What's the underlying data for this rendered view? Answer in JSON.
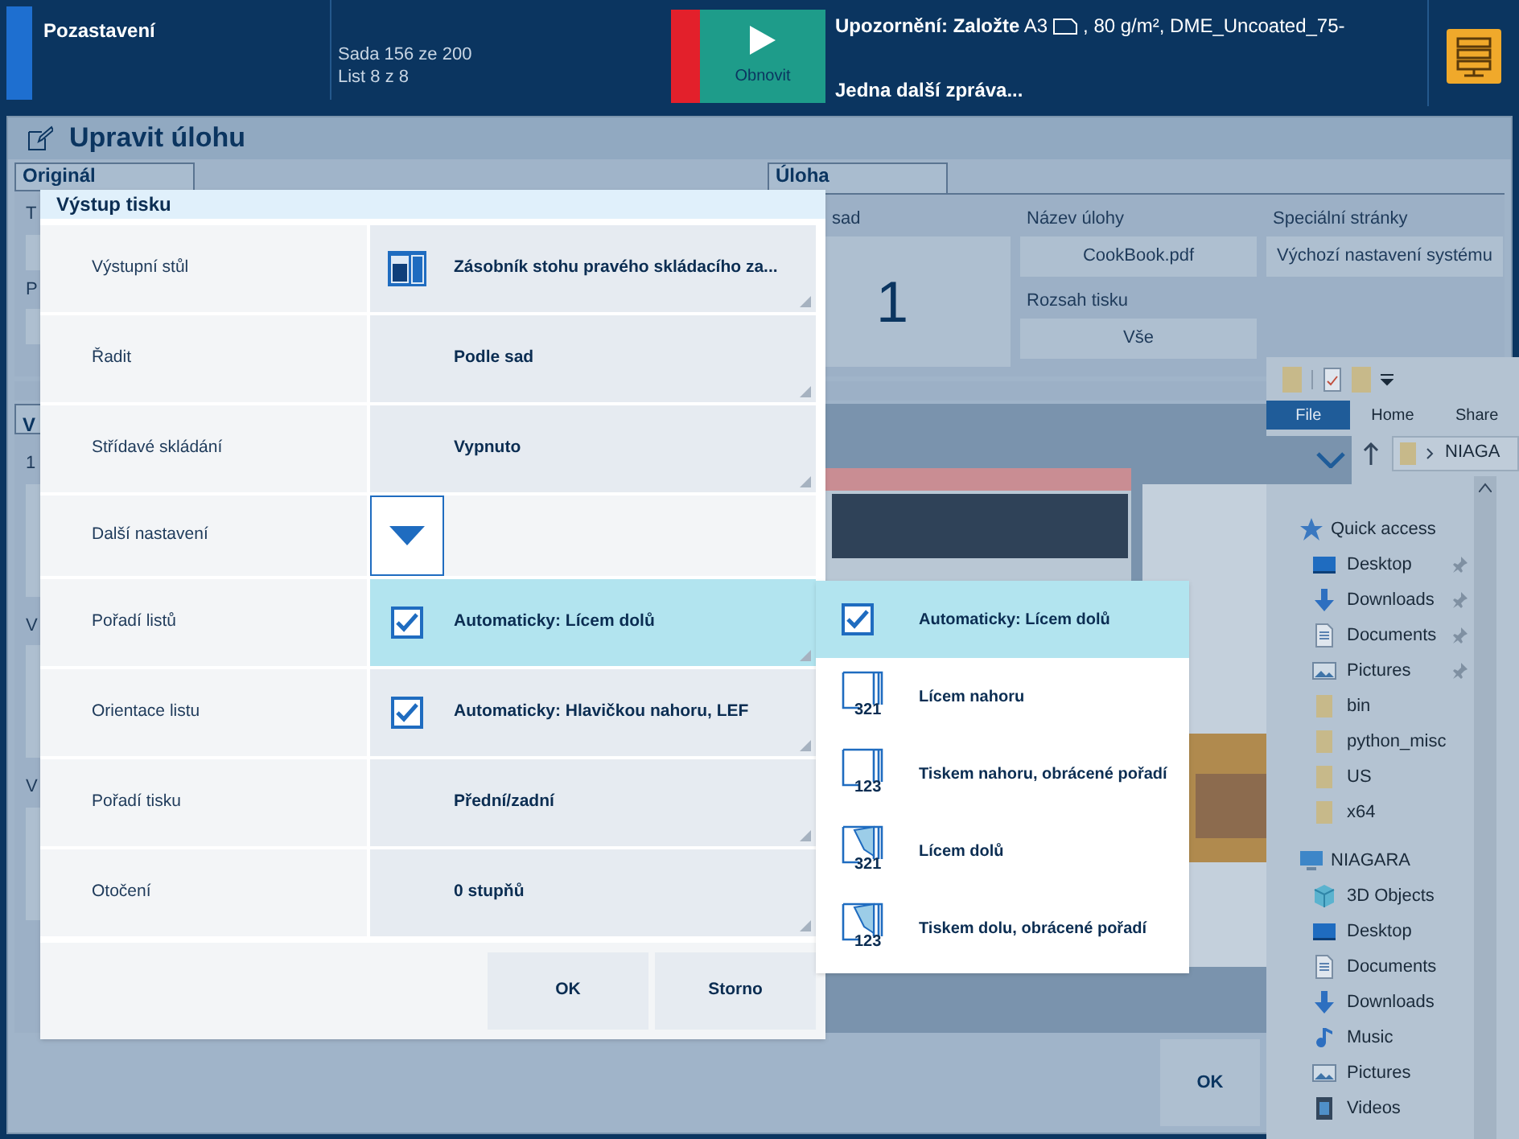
{
  "top_bar": {
    "status": "Pozastavení",
    "set_counter": "Sada 156 ze 200",
    "sheet_counter": "List 8 z 8",
    "resume_button": "Obnovit",
    "message_prefix": "**Upozornění: Založte** A3",
    "message_suffix": ", 80 g/m², DME_Uncoated_75-",
    "more_messages": "Jedna další zpráva..."
  },
  "window": {
    "title": "Upravit úlohu"
  },
  "original_panel": {
    "tab": "Originál",
    "field_labels": [
      "T",
      "P"
    ]
  },
  "job_panel": {
    "tab": "Úloha",
    "columns": [
      [
        {
          "label": "sad",
          "value": "1",
          "kind": "big"
        }
      ],
      [
        {
          "label": "Název úlohy",
          "value": "CookBook.pdf",
          "kind": "field"
        },
        {
          "label": "Rozsah tisku",
          "value": "Vše",
          "kind": "field"
        }
      ],
      [
        {
          "label": "Speciální stránky",
          "value": "Výchozí nastavení systému",
          "kind": "field"
        }
      ]
    ]
  },
  "lower_panel": {
    "tab": "V",
    "field_labels": [
      "1",
      "V",
      "V"
    ]
  },
  "bottom_button": "OK",
  "dialog": {
    "title": "Výstup tisku",
    "rows": [
      {
        "label": "Výstupní stůl",
        "kind": "tray",
        "value": "Zásobník stohu pravého skládacího za...",
        "open": false
      },
      {
        "label": "Řadit",
        "kind": "select",
        "value": "Podle sad",
        "open": false
      },
      {
        "label": "Střídavé skládání",
        "kind": "select",
        "value": "Vypnuto",
        "open": false
      },
      {
        "label": "Další nastavení",
        "kind": "expander",
        "expanded": false
      },
      {
        "label": "Pořadí listů",
        "kind": "checkbox",
        "checked": true,
        "value": "Automaticky: Lícem dolů",
        "open": true
      },
      {
        "label": "Orientace listu",
        "kind": "checkbox",
        "checked": true,
        "value": "Automaticky: Hlavičkou nahoru, LEF",
        "open": false
      },
      {
        "label": "Pořadí tisku",
        "kind": "select",
        "value": "Přední/zadní",
        "open": false
      },
      {
        "label": "Otočení",
        "kind": "select",
        "value": "0 stupňů",
        "open": false
      }
    ],
    "buttons": [
      "OK",
      "Storno"
    ]
  },
  "order_menu": {
    "items": [
      {
        "kind": "check",
        "label": "Automaticky: Lícem dolů",
        "selected": true
      },
      {
        "kind": "stack",
        "digits": "321",
        "label": "Lícem nahoru",
        "selected": false
      },
      {
        "kind": "stack",
        "digits": "123",
        "label": "Tiskem nahoru, obrácené pořadí",
        "selected": false
      },
      {
        "kind": "folded",
        "digits": "321",
        "label": "Lícem dolů",
        "selected": false
      },
      {
        "kind": "folded",
        "digits": "123",
        "label": "Tiskem dolu, obrácené pořadí",
        "selected": false
      }
    ]
  },
  "explorer": {
    "ribbon_tabs": [
      {
        "label": "File",
        "selected": true
      },
      {
        "label": "Home",
        "selected": false
      },
      {
        "label": "Share",
        "selected": false
      }
    ],
    "address": "NIAGA",
    "nav": [
      {
        "label": "Quick access",
        "kind": "star",
        "children": [
          {
            "label": "Desktop",
            "kind": "desktop",
            "pinned": true
          },
          {
            "label": "Downloads",
            "kind": "download",
            "pinned": true
          },
          {
            "label": "Documents",
            "kind": "document",
            "pinned": true
          },
          {
            "label": "Pictures",
            "kind": "picture",
            "pinned": true
          },
          {
            "label": "bin",
            "kind": "folder",
            "pinned": false
          },
          {
            "label": "python_misc",
            "kind": "folder",
            "pinned": false
          },
          {
            "label": "US",
            "kind": "folder",
            "pinned": false
          },
          {
            "label": "x64",
            "kind": "folder",
            "pinned": false
          }
        ]
      },
      {
        "label": "NIAGARA",
        "kind": "pc",
        "children": [
          {
            "label": "3D Objects",
            "kind": "cube",
            "pinned": false
          },
          {
            "label": "Desktop",
            "kind": "desktop",
            "pinned": false
          },
          {
            "label": "Documents",
            "kind": "document",
            "pinned": false
          },
          {
            "label": "Downloads",
            "kind": "download",
            "pinned": false
          },
          {
            "label": "Music",
            "kind": "music",
            "pinned": false
          },
          {
            "label": "Pictures",
            "kind": "picture",
            "pinned": false
          },
          {
            "label": "Videos",
            "kind": "video",
            "pinned": false
          }
        ]
      }
    ]
  }
}
